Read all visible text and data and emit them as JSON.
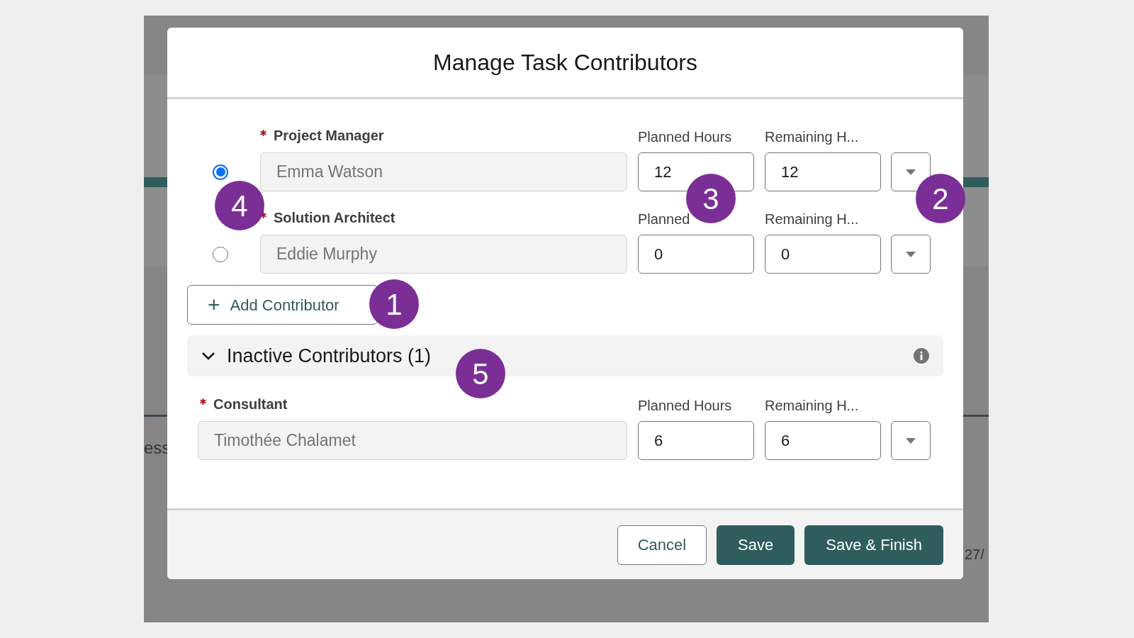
{
  "background": {
    "texts": [
      "ess",
      "27/"
    ]
  },
  "dialog": {
    "title": "Manage Task Contributors",
    "contributors": [
      {
        "role": "Project Manager",
        "required": true,
        "name": "Emma Watson",
        "planned_label": "Planned Hours",
        "planned": "12",
        "remaining_label": "Remaining H...",
        "remaining": "12",
        "selected": true
      },
      {
        "role": "Solution Architect",
        "required": true,
        "name": "Eddie Murphy",
        "planned_label": "Planned",
        "planned": "0",
        "remaining_label": "Remaining H...",
        "remaining": "0",
        "selected": false
      }
    ],
    "add_button": {
      "icon": "+",
      "label": "Add Contributor"
    },
    "inactive_section": {
      "label": "Inactive Contributors (1)",
      "expanded": true,
      "contributors": [
        {
          "role": "Consultant",
          "required": true,
          "name": "Timothée Chalamet",
          "planned_label": "Planned Hours",
          "planned": "6",
          "remaining_label": "Remaining H...",
          "remaining": "6"
        }
      ]
    },
    "buttons": [
      {
        "label": "Cancel",
        "kind": "neutral"
      },
      {
        "label": "Save",
        "kind": "brand"
      },
      {
        "label": "Save & Finish",
        "kind": "brand"
      }
    ]
  },
  "annotations": [
    "4",
    "3",
    "2",
    "1",
    "5"
  ]
}
